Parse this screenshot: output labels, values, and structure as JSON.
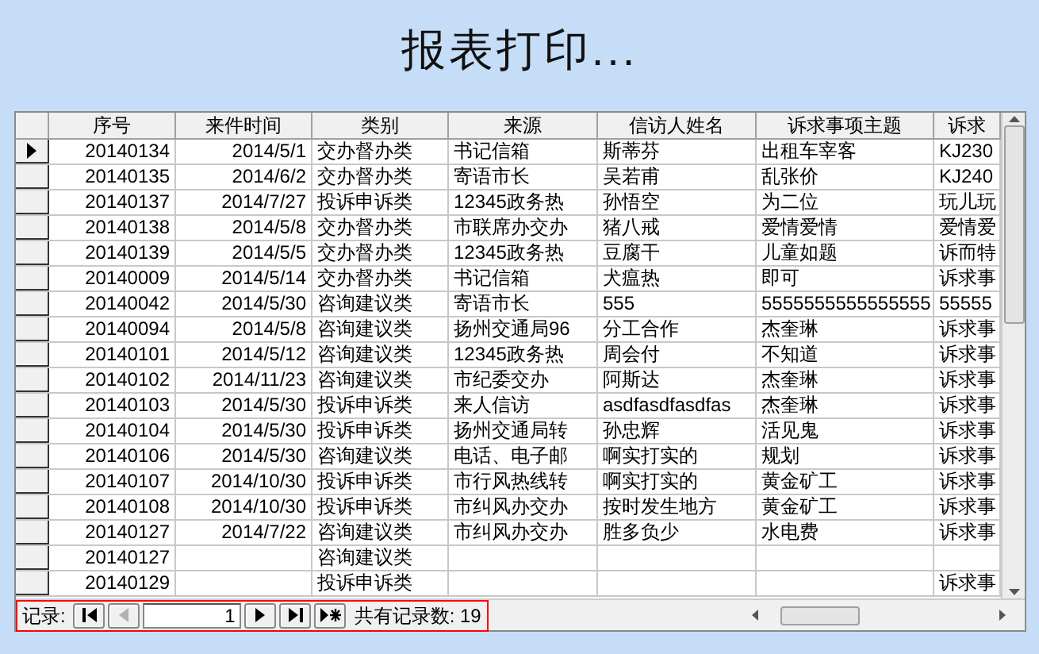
{
  "title": "报表打印...",
  "table": {
    "columns": [
      "序号",
      "来件时间",
      "类别",
      "来源",
      "信访人姓名",
      "诉求事项主题",
      "诉求"
    ],
    "rows": [
      {
        "selected": true,
        "cells": [
          "20140134",
          "2014/5/1",
          "交办督办类",
          "书记信箱",
          "斯蒂芬",
          "出租车宰客",
          "KJ230"
        ]
      },
      {
        "selected": false,
        "cells": [
          "20140135",
          "2014/6/2",
          "交办督办类",
          "寄语市长",
          "吴若甫",
          "乱张价",
          "KJ240"
        ]
      },
      {
        "selected": false,
        "cells": [
          "20140137",
          "2014/7/27",
          "投诉申诉类",
          "12345政务热",
          "孙悟空",
          "为二位",
          "玩儿玩"
        ]
      },
      {
        "selected": false,
        "cells": [
          "20140138",
          "2014/5/8",
          "交办督办类",
          "市联席办交办",
          "猪八戒",
          "爱情爱情",
          "爱情爱"
        ]
      },
      {
        "selected": false,
        "cells": [
          "20140139",
          "2014/5/5",
          "交办督办类",
          "12345政务热",
          "豆腐干",
          "儿童如题",
          "诉而特"
        ]
      },
      {
        "selected": false,
        "cells": [
          "20140009",
          "2014/5/14",
          "交办督办类",
          "书记信箱",
          "犬瘟热",
          "即可",
          "诉求事"
        ]
      },
      {
        "selected": false,
        "cells": [
          "20140042",
          "2014/5/30",
          "咨询建议类",
          "寄语市长",
          "555",
          "5555555555555555",
          "55555"
        ]
      },
      {
        "selected": false,
        "cells": [
          "20140094",
          "2014/5/8",
          "咨询建议类",
          "扬州交通局96",
          "分工合作",
          "杰奎琳",
          "诉求事"
        ]
      },
      {
        "selected": false,
        "cells": [
          "20140101",
          "2014/5/12",
          "咨询建议类",
          "12345政务热",
          "周会付",
          "不知道",
          "诉求事"
        ]
      },
      {
        "selected": false,
        "cells": [
          "20140102",
          "2014/11/23",
          "咨询建议类",
          "市纪委交办",
          "阿斯达",
          "杰奎琳",
          "诉求事"
        ]
      },
      {
        "selected": false,
        "cells": [
          "20140103",
          "2014/5/30",
          "投诉申诉类",
          "来人信访",
          "asdfasdfasdfas",
          "杰奎琳",
          "诉求事"
        ]
      },
      {
        "selected": false,
        "cells": [
          "20140104",
          "2014/5/30",
          "投诉申诉类",
          "扬州交通局转",
          "孙忠辉",
          "活见鬼",
          "诉求事"
        ]
      },
      {
        "selected": false,
        "cells": [
          "20140106",
          "2014/5/30",
          "咨询建议类",
          "电话、电子邮",
          "啊实打实的",
          "规划",
          "诉求事"
        ]
      },
      {
        "selected": false,
        "cells": [
          "20140107",
          "2014/10/30",
          "投诉申诉类",
          "市行风热线转",
          "啊实打实的",
          "黄金矿工",
          "诉求事"
        ]
      },
      {
        "selected": false,
        "cells": [
          "20140108",
          "2014/10/30",
          "投诉申诉类",
          "市纠风办交办",
          "按时发生地方",
          "黄金矿工",
          "诉求事"
        ]
      },
      {
        "selected": false,
        "cells": [
          "20140127",
          "2014/7/22",
          "咨询建议类",
          "市纠风办交办",
          "胜多负少",
          "水电费",
          "诉求事"
        ]
      },
      {
        "selected": false,
        "cells": [
          "20140127",
          null,
          "咨询建议类",
          null,
          null,
          null,
          null
        ]
      },
      {
        "selected": false,
        "cells": [
          "20140129",
          null,
          "投诉申诉类",
          null,
          null,
          null,
          "诉求事"
        ]
      }
    ]
  },
  "navigator": {
    "label": "记录:",
    "current": "1",
    "prev_disabled": true,
    "total": "共有记录数: 19"
  }
}
